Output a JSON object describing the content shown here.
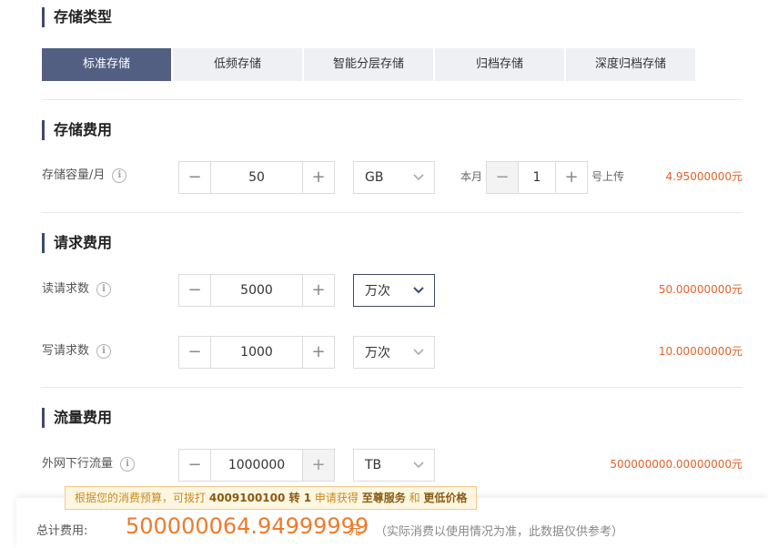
{
  "sections": {
    "storage_type": "存储类型",
    "storage_fee": "存储费用",
    "request_fee": "请求费用",
    "traffic_fee": "流量费用"
  },
  "tabs": [
    "标准存储",
    "低频存储",
    "智能分层存储",
    "归档存储",
    "深度归档存储"
  ],
  "storage": {
    "label": "存储容量/月",
    "value": "50",
    "unit": "GB",
    "month_prefix": "本月",
    "day_value": "1",
    "day_suffix": "号上传",
    "price": "4.95000000元"
  },
  "read": {
    "label": "读请求数",
    "value": "5000",
    "unit": "万次",
    "price": "50.00000000元"
  },
  "write": {
    "label": "写请求数",
    "value": "1000",
    "unit": "万次",
    "price": "10.00000000元"
  },
  "traffic": {
    "label": "外网下行流量",
    "value": "1000000",
    "unit": "TB",
    "price": "500000000.00000000元"
  },
  "tip": {
    "prefix": "根据您的消费预算，可拨打",
    "phone": "4009100100 转 1",
    "mid": "申请获得",
    "service": "至尊服务",
    "and": "和",
    "price": "更低价格"
  },
  "total": {
    "label": "总计费用:",
    "value": "500000064.94999999",
    "unit": "元",
    "note": "（实际消费以使用情况为准，此数据仅供参考）"
  },
  "icons": {
    "minus": "−",
    "plus": "+",
    "info": "i"
  }
}
